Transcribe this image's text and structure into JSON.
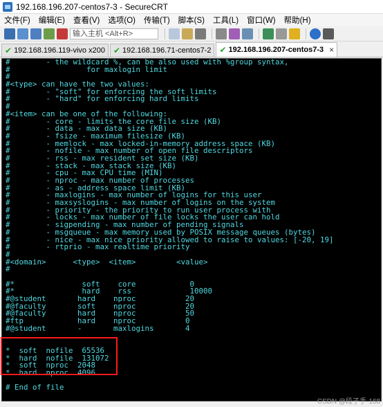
{
  "window": {
    "title": "192.168.196.207-centos7-3 - SecureCRT"
  },
  "menu": [
    "文件(F)",
    "编辑(E)",
    "查看(V)",
    "选项(O)",
    "传输(T)",
    "脚本(S)",
    "工具(L)",
    "窗口(W)",
    "帮助(H)"
  ],
  "toolbar": {
    "quick_connect_placeholder": "输入主机 <Alt+R>"
  },
  "tabs": [
    {
      "label": "192.168.196.119-vivo x200",
      "active": false
    },
    {
      "label": "192.168.196.71-centos7-2",
      "active": false
    },
    {
      "label": "192.168.196.207-centos7-3",
      "active": true,
      "close": "×"
    }
  ],
  "terminal": {
    "lines": [
      "#        - the wildcard %, can be also used with %group syntax,",
      "#                 for maxlogin limit",
      "#",
      "#<type> can have the two values:",
      "#        - \"soft\" for enforcing the soft limits",
      "#        - \"hard\" for enforcing hard limits",
      "#",
      "#<item> can be one of the following:",
      "#        - core - limits the core file size (KB)",
      "#        - data - max data size (KB)",
      "#        - fsize - maximum filesize (KB)",
      "#        - memlock - max locked-in-memory address space (KB)",
      "#        - nofile - max number of open file descriptors",
      "#        - rss - max resident set size (KB)",
      "#        - stack - max stack size (KB)",
      "#        - cpu - max CPU time (MIN)",
      "#        - nproc - max number of processes",
      "#        - as - address space limit (KB)",
      "#        - maxlogins - max number of logins for this user",
      "#        - maxsyslogins - max number of logins on the system",
      "#        - priority - the priority to run user process with",
      "#        - locks - max number of file locks the user can hold",
      "#        - sigpending - max number of pending signals",
      "#        - msgqueue - max memory used by POSIX message queues (bytes)",
      "#        - nice - max nice priority allowed to raise to values: [-20, 19]",
      "#        - rtprio - max realtime priority",
      "#",
      "#<domain>      <type>  <item>         <value>",
      "#",
      "",
      "#*               soft    core            0",
      "#*               hard    rss             10000",
      "#@student       hard    nproc           20",
      "#@faculty       soft    nproc           20",
      "#@faculty       hard    nproc           50",
      "#ftp            hard    nproc           0",
      "#@student       -       maxlogins       4",
      "",
      "",
      "*  soft  nofile  65536",
      "*  hard  nofile  131072",
      "*  soft  nproc  2048",
      "*  hard  nproc  4096",
      "",
      "# End of file"
    ]
  },
  "watermark": "CSDN @段子手-168"
}
